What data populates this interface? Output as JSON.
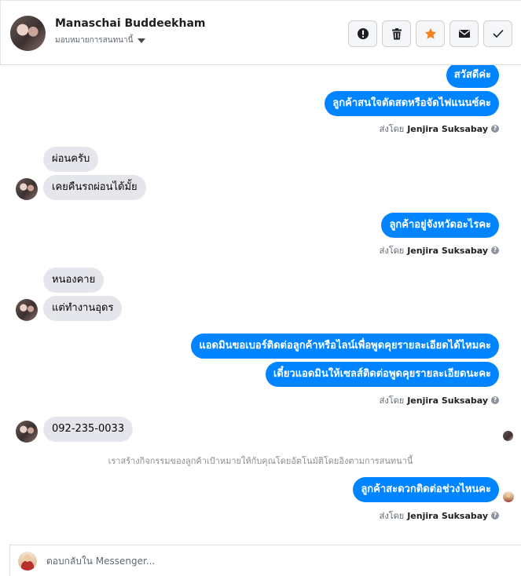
{
  "header": {
    "contact_name": "Manaschai Buddeekham",
    "subtitle": "มอบหมายการสนทนานี้",
    "actions": [
      {
        "name": "spam-report",
        "icon": "exclamation-circle-icon"
      },
      {
        "name": "delete",
        "icon": "trash-icon"
      },
      {
        "name": "star",
        "icon": "star-icon",
        "color": "#f5821f"
      },
      {
        "name": "mark-unread",
        "icon": "envelope-icon"
      },
      {
        "name": "done",
        "icon": "checkmark-icon"
      }
    ]
  },
  "messages": {
    "m1": "สวัสดีค่ะ",
    "m2": "ลูกค้าสนใจตัดสดหรือจัดไฟแนนซ์คะ",
    "m3": "ผ่อนครับ",
    "m4": "เคยคืนรถผ่อนได้มั้ย",
    "m5": "ลูกค้าอยู่จังหวัดอะไรคะ",
    "m6": "หนองคาย",
    "m7": "แต่ทำงานอุดร",
    "m8": "แอดมินขอเบอร์ติดต่อลูกค้าหรือไลน์เพื่อพูดคุยรายละเอียดได้ไหมคะ",
    "m9": "เดี๋ยวแอดมินให้เซลส์ติดต่อพูดคุยรายละเอียดนะคะ",
    "m10": "092-235-0033",
    "m11": "ลูกค้าสะดวกติดต่อช่วงไหนคะ"
  },
  "sent_by": {
    "prefix": "ส่งโดย",
    "agent": "Jenjira Suksabay"
  },
  "system_note": "เราสร้างกิจกรรมของลูกค้าเป้าหมายให้กับคุณโดยอัตโนมัติโดยอิงตามการสนทนานี้",
  "reply": {
    "placeholder": "ตอบกลับใน Messenger..."
  },
  "colors": {
    "outgoing_bubble": "#0084ff",
    "incoming_bubble": "#e4e6eb",
    "star_accent": "#f5821f"
  }
}
